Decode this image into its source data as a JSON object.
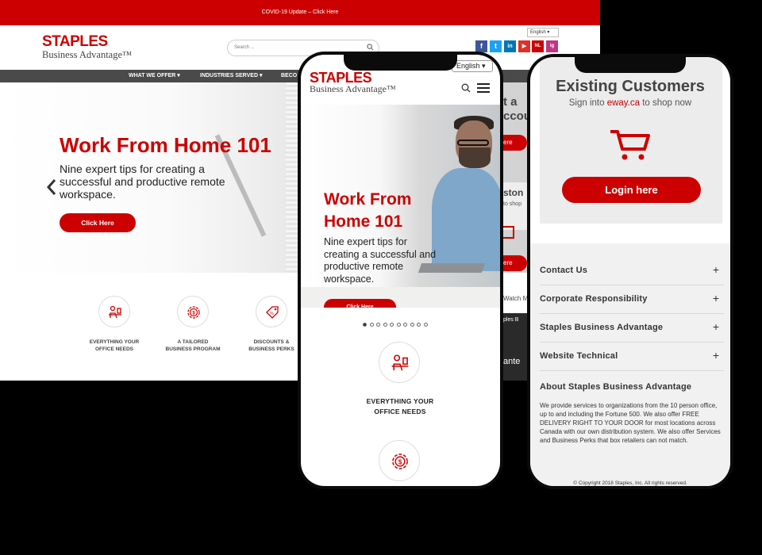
{
  "desktop": {
    "banner": "COVID-19 Update – Click Here",
    "logo_line1": "STAPLES",
    "logo_line2": "Business Advantage™",
    "search_placeholder": "Search ...",
    "language": "English",
    "social": [
      "f",
      "t",
      "in",
      "▶",
      "NL",
      "ig"
    ],
    "nav": [
      "WHAT WE OFFER  ▾",
      "INDUSTRIES SERVED  ▾",
      "BECO"
    ],
    "hero_title": "Work From Home 101",
    "hero_subtitle": "Nine expert tips for creating a successful and productive remote workspace.",
    "hero_button": "Click Here",
    "features": [
      {
        "line1": "EVERYTHING YOUR",
        "line2": "OFFICE NEEDS"
      },
      {
        "line1": "A TAILORED",
        "line2": "BUSINESS PROGRAM"
      },
      {
        "line1": "DISCOUNTS &",
        "line2": "BUSINESS PERKS"
      }
    ],
    "peek": [
      "t a",
      "ccou",
      "ere",
      "ston",
      "to shop",
      "ty",
      "ere",
      "Watch M",
      "ples B",
      "ante"
    ]
  },
  "phone_mobile": {
    "language": "English",
    "logo_line1": "STAPLES",
    "logo_line2": "Business Advantage™",
    "hero_title": "Work From Home 101",
    "hero_subtitle": "Nine expert tips for creating a successful and productive remote workspace.",
    "hero_button": "Click Here",
    "carousel_dots": 10,
    "carousel_active": 1,
    "feature_caption_line1": "EVERYTHING YOUR",
    "feature_caption_line2": "OFFICE NEEDS"
  },
  "phone_footer": {
    "heading": "Existing Customers",
    "sign_prefix": "Sign into ",
    "sign_link": "eway.ca",
    "sign_suffix": " to shop now",
    "login_button": "Login here",
    "accordion": [
      "Contact Us",
      "Corporate Responsibility",
      "Staples Business Advantage",
      "Website Technical"
    ],
    "about_title": "About Staples Business Advantage",
    "about_body": "We provide services to organizations from the 10 person office, up to and including the Fortune 500. We also offer FREE DELIVERY RIGHT TO YOUR DOOR for most locations across Canada with our own distribution system. We also offer Services and Business Perks that box retailers can not match.",
    "copyright": "© Copyright 2018 Staples, Inc. All rights reserved."
  },
  "colors": {
    "brand_red": "#cc0000",
    "nav_gray": "#4a4a4a",
    "panel_gray": "#f1f1f1"
  }
}
